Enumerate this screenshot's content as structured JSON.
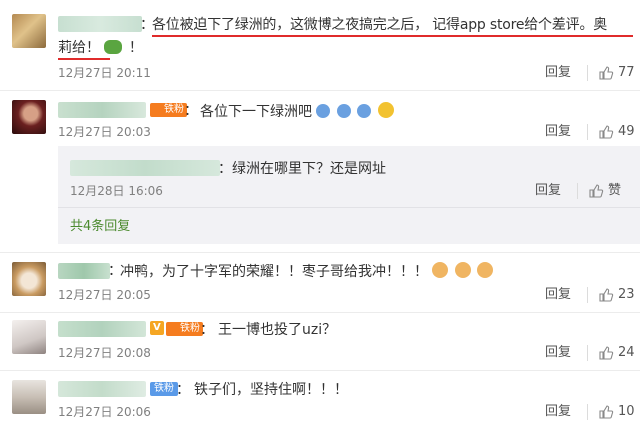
{
  "comments": [
    {
      "id": "c1",
      "text_line1": "各位被迫下了绿洲的，这微博之夜搞完之后， 记得app store给个差评。奥",
      "text_line2": "莉给！",
      "text_line2_tail": "！",
      "time": "12月27日 20:11",
      "reply_label": "回复",
      "likes": "77"
    },
    {
      "id": "c2",
      "badge": "铁粉",
      "text": "各位下一下绿洲吧",
      "time": "12月27日 20:03",
      "reply_label": "回复",
      "likes": "49",
      "subreply": {
        "text": "绿洲在哪里下？还是网址",
        "time": "12月28日 16:06",
        "reply_label": "回复",
        "like_label": "赞",
        "view_all": "共4条回复"
      }
    },
    {
      "id": "c3",
      "text": "冲鸭，为了十字军的荣耀！！枣子哥给我冲！！！",
      "time": "12月27日 20:05",
      "reply_label": "回复",
      "likes": "23"
    },
    {
      "id": "c4",
      "badge_v": "V",
      "badge": "铁粉",
      "text": "王一博也投了uzi？",
      "time": "12月27日 20:08",
      "reply_label": "回复",
      "likes": "24"
    },
    {
      "id": "c5",
      "badge": "铁粉",
      "text": "铁子们，坚持住啊！！！",
      "time": "12月27日 20:06",
      "reply_label": "回复",
      "likes": "10"
    }
  ],
  "colors": {
    "link_green": "#4c8b2f",
    "badge_orange": "#f57c1f",
    "badge_blue": "#5a9ae8",
    "underline_red": "#e02b2b",
    "subbox_bg": "#f2f2f5"
  },
  "icons": {
    "like": "thumbs-up-icon",
    "emoji_blue": "crying-face-icon",
    "emoji_cat": "cat-face-icon",
    "emoji_caterpillar": "caterpillar-icon"
  }
}
